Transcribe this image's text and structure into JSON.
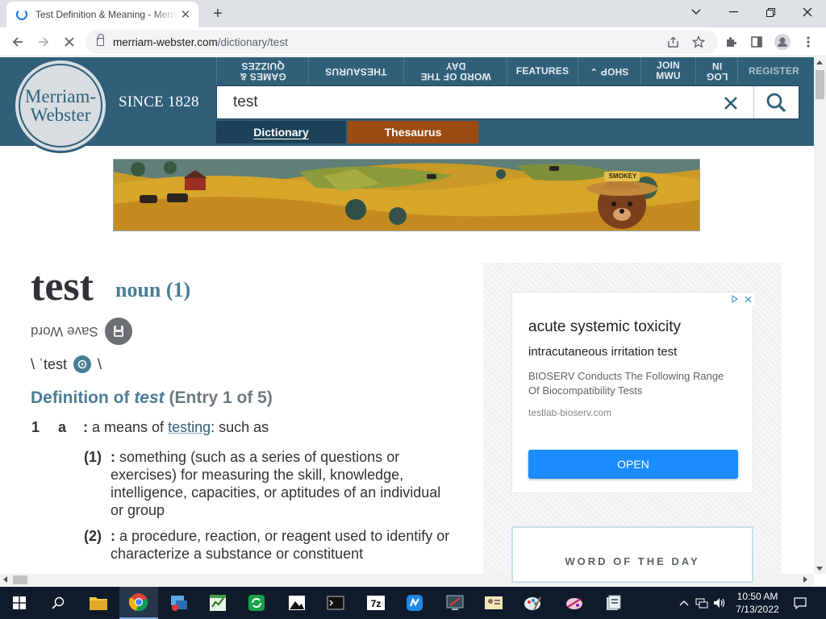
{
  "browser": {
    "tab_title": "Test Definition & Meaning - Merriam-Webster",
    "url_host": "merriam-webster.com",
    "url_path": "/dictionary/test"
  },
  "header": {
    "logo_line1": "Merriam-",
    "logo_line2": "Webster",
    "since": "SINCE 1828",
    "nav": [
      {
        "label": "GAMES & QUIZZES",
        "flipped": true
      },
      {
        "label": "THESAURUS",
        "flipped": true
      },
      {
        "label": "WORD OF THE DAY",
        "flipped": true
      },
      {
        "label": "FEATURES",
        "flipped": false
      },
      {
        "label": "SHOP",
        "flipped": true
      },
      {
        "label": "JOIN MWU",
        "flipped": false
      },
      {
        "label": "LOG IN",
        "flipped": true
      },
      {
        "label": "REGISTER",
        "flipped": false
      }
    ],
    "search_value": "test",
    "tab_dictionary": "Dictionary",
    "tab_thesaurus": "Thesaurus"
  },
  "banner": {
    "sign_text": "SMOKEY"
  },
  "entry": {
    "headword": "test",
    "function_label": "noun (1)",
    "save_word": "Save Word",
    "pronunciation": "\\ ˈtest",
    "pronunciation_close": "\\",
    "definition_prefix": "Definition of ",
    "definition_word": "test",
    "definition_suffix": " (Entry 1 of 5)",
    "sense1_num": "1",
    "sense1_letter": "a",
    "sense1_colon": ":",
    "sense1_text_a": " a means of ",
    "sense1_link": "testing",
    "sense1_text_b": ": such as",
    "sub1_num": "(1)",
    "sub1_colon": ":",
    "sub1_text": "something (such as a series of questions or exercises) for measuring the skill, knowledge, intelligence, capacities, or aptitudes of an individual or group",
    "sub2_num": "(2)",
    "sub2_colon": ":",
    "sub2_text": "a procedure, reaction, or reagent used to identify or characterize a substance or constituent"
  },
  "ad": {
    "title": "acute systemic toxicity",
    "subtitle": "intracutaneous irritation test",
    "body": "BIOSERV Conducts The Following Range Of Biocompatibility Tests",
    "url": "testlab-bioserv.com",
    "cta": "OPEN"
  },
  "wotd": {
    "label": "WORD OF THE DAY"
  },
  "taskbar": {
    "time": "10:50 AM",
    "date": "7/13/2022"
  },
  "colors": {
    "header_blue": "#305f7a",
    "dictionary_tab": "#1c4258",
    "thesaurus_tab": "#9c4c12",
    "accent_teal": "#4a7d95",
    "ad_button": "#1a8cff"
  }
}
